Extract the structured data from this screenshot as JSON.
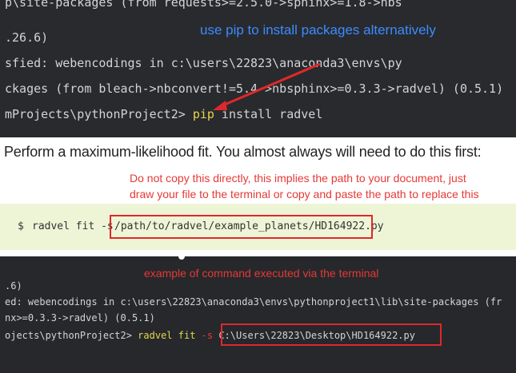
{
  "terminal_top": {
    "lines": [
      "p\\site-packages (from requests>=2.5.0->sphinx>=1.8->nbs",
      ".26.6)",
      "sfied: webencodings in c:\\users\\22823\\anaconda3\\envs\\py",
      "ckages (from bleach->nbconvert!=5.4->nbsphinx>=0.3.3->radvel) (0.5.1)"
    ],
    "prompt": "mProjects\\pythonProject2> ",
    "command_keyword": "pip",
    "command_rest": " install radvel"
  },
  "annotations": {
    "pip_note": "use pip to install packages alternatively",
    "path_note_line1": "Do not copy this directly, this implies the path to your document, just",
    "path_note_line2": "draw your file to the terminal or copy and paste the path to replace this",
    "example_note": "example of command executed via the terminal"
  },
  "doc": {
    "heading": "Perform a maximum-likelihood fit. You almost always will need to do this first:",
    "code_prompt": "$",
    "code_command": "radvel fit -s",
    "code_path": "/path/to/radvel/example_planets/HD164922.py"
  },
  "terminal_bottom": {
    "lines": [
      ".6)",
      "ed: webencodings in c:\\users\\22823\\anaconda3\\envs\\pythonproject1\\lib\\site-packages (fr",
      "nx>=0.3.3->radvel) (0.5.1)"
    ],
    "prompt": "ojects\\pythonProject2> ",
    "command": "radvel fit",
    "flag": " -s ",
    "path": "C:\\Users\\22823\\Desktop\\HD164922.py"
  },
  "colors": {
    "terminal_bg": "#282a2e",
    "code_bg": "#eef5d6",
    "annotation_red": "#e53935",
    "annotation_blue": "#3d8bff",
    "command_yellow": "#e6d64a"
  }
}
